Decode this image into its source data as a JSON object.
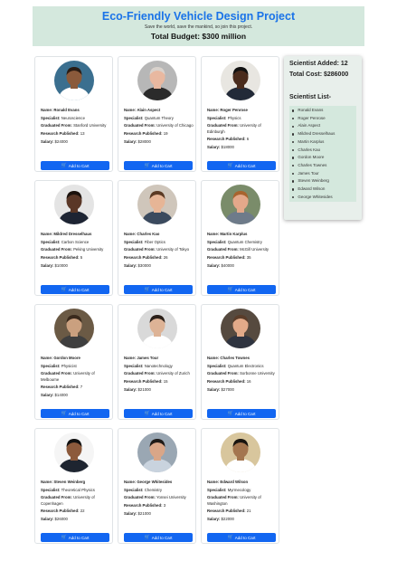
{
  "header": {
    "title": "Eco-Friendly Vehicle Design Project",
    "motto": "Save the world, save the mankind, so join this project.",
    "budget": "Total Budget: $300 million"
  },
  "labels": {
    "name": "Name:",
    "speciality": "Specialist:",
    "graduated": "Graduated From:",
    "research": "Research Published:",
    "salary": "Salary:",
    "add_to_cart": "Add to Cart"
  },
  "scientists": [
    {
      "name": "Ronald Evans",
      "speciality": "Neuroscience",
      "graduated": "Stanford University",
      "research": "13",
      "salary": "$24000",
      "skin": "#8a5a3b",
      "hair": "#2a1c14",
      "bg": "#3b6f8f",
      "shirt": "#ffffff"
    },
    {
      "name": "Alain Aspect",
      "speciality": "Quantum Theory",
      "graduated": "University of Chicago",
      "research": "19",
      "salary": "$28000",
      "skin": "#e8b8a0",
      "hair": "#d9d2cc",
      "bg": "#b7b7b7",
      "shirt": "#2b2b2b"
    },
    {
      "name": "Roger Penrose",
      "speciality": "Physics",
      "graduated": "University of Edinburgh",
      "research": "6",
      "salary": "$18000",
      "skin": "#4a2c1d",
      "hair": "#111111",
      "bg": "#e8e6e1",
      "shirt": "#222a38"
    },
    {
      "name": "Mildred Dresselhaus",
      "speciality": "Carbon Science",
      "graduated": "Peking University",
      "research": "5",
      "salary": "$10000",
      "skin": "#5a3727",
      "hair": "#1b120d",
      "bg": "#e4e4e4",
      "shirt": "#1d2433"
    },
    {
      "name": "Charles Kao",
      "speciality": "Fiber Optics",
      "graduated": "University of Tokyo",
      "research": "26",
      "salary": "$30000",
      "skin": "#e6b596",
      "hair": "#5b3a24",
      "bg": "#cfc6bb",
      "shirt": "#3b4a5e"
    },
    {
      "name": "Martin Karplus",
      "speciality": "Quantum Chemistry",
      "graduated": "McGill University",
      "research": "35",
      "salary": "$40000",
      "skin": "#e3a88a",
      "hair": "#a8642e",
      "bg": "#7a8c6a",
      "shirt": "#6e7b8a"
    },
    {
      "name": "Gordon Moore",
      "speciality": "Physicist",
      "graduated": "University of Melbourne",
      "research": "7",
      "salary": "$14000",
      "skin": "#caa07f",
      "hair": "#3a2a1d",
      "bg": "#6b5a45",
      "shirt": "#3f3f3f"
    },
    {
      "name": "James Tour",
      "speciality": "Nanotechnology",
      "graduated": "University of Zurich",
      "research": "15",
      "salary": "$21000",
      "skin": "#ddb396",
      "hair": "#2b2019",
      "bg": "#d9d9d9",
      "shirt": "#ffffff"
    },
    {
      "name": "Charles Townes",
      "speciality": "Quantum Electronics",
      "graduated": "Sorbonne University",
      "research": "16",
      "salary": "$27000",
      "skin": "#e2aa89",
      "hair": "#5a3d2a",
      "bg": "#564a3f",
      "shirt": "#2f3440"
    },
    {
      "name": "Steven Weinberg",
      "speciality": "Theoretical Physics",
      "graduated": "University of Copenhagen",
      "research": "22",
      "salary": "$26000",
      "skin": "#8c5a3c",
      "hair": "#111111",
      "bg": "#f5f5f5",
      "shirt": "#1e2530"
    },
    {
      "name": "George Whitesides",
      "speciality": "Chemistry",
      "graduated": "Yonsei University",
      "research": "3",
      "salary": "$21000",
      "skin": "#d9a688",
      "hair": "#1f1a17",
      "bg": "#9aa7b3",
      "shirt": "#c9d3de"
    },
    {
      "name": "Edward Wilson",
      "speciality": "Myrmecology",
      "graduated": "University of Washington",
      "research": "21",
      "salary": "$22000",
      "skin": "#a4764f",
      "hair": "#181410",
      "bg": "#d8c69d",
      "shirt": "#ffffff"
    }
  ],
  "sidebar": {
    "added": "Scientist Added: 12",
    "cost": "Total Cost: $286000",
    "list_title": "Scientist List-",
    "list": [
      "Ronald Evans",
      "Roger Penrose",
      "Alain Aspect",
      "Mildred Dresselhaus",
      "Martin Karplus",
      "Charles Kao",
      "Gordon Moore",
      "Charles Townes",
      "James Tour",
      "Steven Weinberg",
      "Edward Wilson",
      "George Whitesides"
    ]
  }
}
